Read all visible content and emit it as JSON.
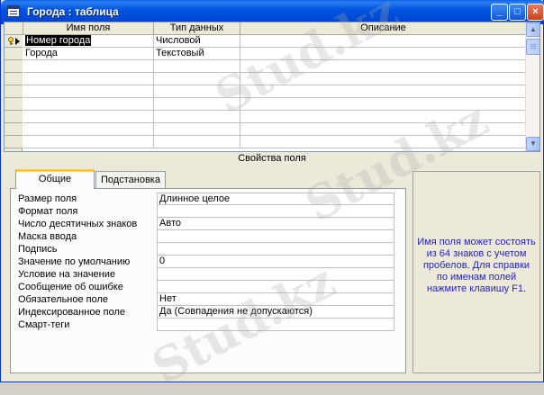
{
  "window": {
    "title": "Города : таблица",
    "buttons": [
      "_",
      "□",
      "×"
    ]
  },
  "grid": {
    "columns": [
      "Имя поля",
      "Тип данных",
      "Описание"
    ],
    "rows": [
      {
        "name": "Номер города",
        "type": "Числовой",
        "desc": "",
        "key": true,
        "current": true
      },
      {
        "name": "Города",
        "type": "Текстовый",
        "desc": "",
        "key": false,
        "current": false
      }
    ],
    "scroll_up": "▲",
    "scroll_down": "▼"
  },
  "props": {
    "title": "Свойства поля",
    "tabs": [
      "Общие",
      "Подстановка"
    ],
    "rows": [
      {
        "label": "Размер поля",
        "value": "Длинное целое"
      },
      {
        "label": "Формат поля",
        "value": ""
      },
      {
        "label": "Число десятичных знаков",
        "value": "Авто"
      },
      {
        "label": "Маска ввода",
        "value": ""
      },
      {
        "label": "Подпись",
        "value": ""
      },
      {
        "label": "Значение по умолчанию",
        "value": "0"
      },
      {
        "label": "Условие на значение",
        "value": ""
      },
      {
        "label": "Сообщение об ошибке",
        "value": ""
      },
      {
        "label": "Обязательное поле",
        "value": "Нет"
      },
      {
        "label": "Индексированное поле",
        "value": "Да (Совпадения не допускаются)"
      },
      {
        "label": "Смарт-теги",
        "value": ""
      }
    ]
  },
  "help": {
    "text": "Имя поля может состоять из 64 знаков с учетом пробелов. Для справки по именам полей нажмите клавишу F1."
  },
  "watermark": {
    "text": "Stud.kz"
  }
}
